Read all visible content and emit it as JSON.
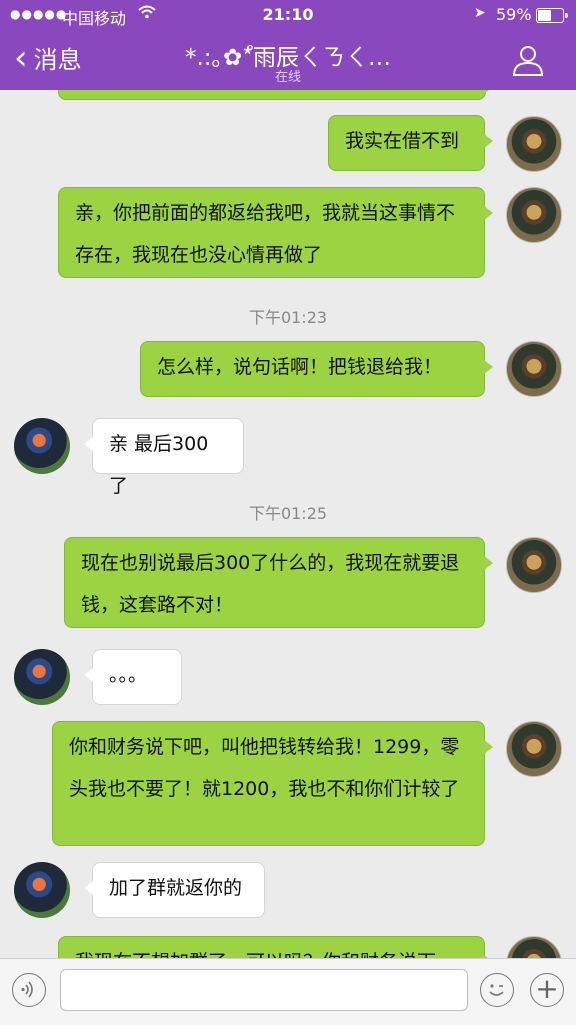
{
  "status_bar": {
    "signal": "●●●●●",
    "carrier": "中国移动",
    "time": "21:10",
    "battery": "59%"
  },
  "nav": {
    "back_label": "消息",
    "title": "*.:｡✿*゚雨辰ㄑㄋㄑ…",
    "subtitle": "在线"
  },
  "messages": [
    {
      "type": "out",
      "text": "我实在借不到"
    },
    {
      "type": "out",
      "text": "亲，你把前面的都返给我吧，我就当这事情不存在，我现在也没心情再做了"
    },
    {
      "type": "time",
      "text": "下午01:23"
    },
    {
      "type": "out",
      "text": "怎么样，说句话啊！把钱退给我！"
    },
    {
      "type": "in",
      "text": "亲 最后300了"
    },
    {
      "type": "time",
      "text": "下午01:25"
    },
    {
      "type": "out",
      "text": "现在也别说最后300了什么的，我现在就要退钱，这套路不对！"
    },
    {
      "type": "in",
      "text": "。。。"
    },
    {
      "type": "out",
      "text": "你和财务说下吧，叫他把钱转给我！1299，零头我也不要了！就1200，我也不和你们计较了"
    },
    {
      "type": "in",
      "text": "加了群就返你的"
    },
    {
      "type": "out",
      "text": "我现在不想加群了，可以吗？你和财务说下"
    }
  ],
  "input": {
    "placeholder": ""
  }
}
